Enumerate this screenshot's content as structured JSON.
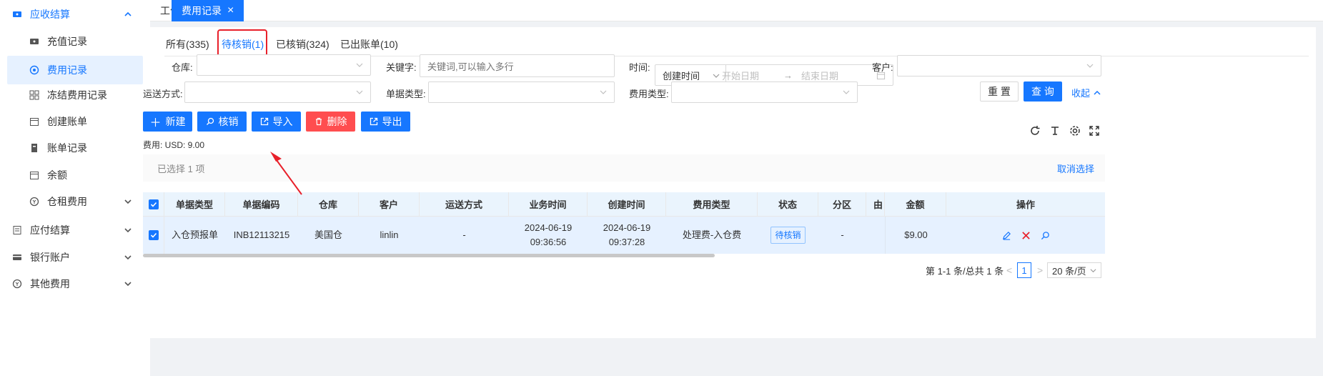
{
  "sidebar": {
    "items": [
      {
        "label": "应收结算",
        "icon": "ticket-icon",
        "level": "top",
        "expanded": true
      },
      {
        "label": "充值记录",
        "icon": "ticket-icon",
        "level": "sub"
      },
      {
        "label": "费用记录",
        "icon": "target-icon",
        "level": "sub",
        "active": true
      },
      {
        "label": "冻结费用记录",
        "icon": "grid-icon",
        "level": "sub"
      },
      {
        "label": "创建账单",
        "icon": "calendar-icon",
        "level": "sub"
      },
      {
        "label": "账单记录",
        "icon": "document-icon",
        "level": "sub"
      },
      {
        "label": "余额",
        "icon": "calendar-icon",
        "level": "sub"
      },
      {
        "label": "仓租费用",
        "icon": "coin-icon",
        "level": "sub",
        "collapsible": true
      },
      {
        "label": "应付结算",
        "icon": "receipt-icon",
        "level": "top",
        "collapsible": true
      },
      {
        "label": "银行账户",
        "icon": "card-icon",
        "level": "top",
        "collapsible": true
      },
      {
        "label": "其他费用",
        "icon": "coin-icon",
        "level": "top",
        "collapsible": true
      }
    ]
  },
  "page_tabs": [
    {
      "label": "工作台"
    },
    {
      "label": "费用记录",
      "active": true
    }
  ],
  "status_tabs": [
    {
      "label": "所有(335)"
    },
    {
      "label": "待核销(1)",
      "active": true
    },
    {
      "label": "已核销(324)"
    },
    {
      "label": "已出账单(10)"
    }
  ],
  "filters": {
    "warehouse_label": "仓库:",
    "keyword_label": "关键字:",
    "keyword_placeholder": "关键词,可以输入多行",
    "time_label": "时间:",
    "time_type": "创建时间",
    "start_date_placeholder": "开始日期",
    "range_arrow": "→",
    "end_date_placeholder": "结束日期",
    "customer_label": "客户:",
    "shipping_label": "运送方式:",
    "doc_type_label": "单据类型:",
    "fee_type_label": "费用类型:",
    "reset": "重 置",
    "search": "查 询",
    "collapse": "收起"
  },
  "actions": {
    "new": "新建",
    "verify": "核销",
    "import": "导入",
    "delete": "删除",
    "export": "导出"
  },
  "fee_summary": "费用: USD: 9.00",
  "selection": {
    "text": "已选择 1 项",
    "cancel": "取消选择"
  },
  "table": {
    "columns": [
      "单据类型",
      "单据编码",
      "仓库",
      "客户",
      "运送方式",
      "业务时间",
      "创建时间",
      "费用类型",
      "状态",
      "分区",
      "由",
      "金额",
      "操作"
    ],
    "rows": [
      {
        "doc_type": "入仓预报单",
        "doc_code": "INB12113215",
        "warehouse": "美国仓",
        "customer": "linlin",
        "shipping": "-",
        "biz_date": "2024-06-19",
        "biz_time": "09:36:56",
        "created_date": "2024-06-19",
        "created_time": "09:37:28",
        "fee_type": "处理费-入仓费",
        "status": "待核销",
        "zone": "-",
        "amount": "$9.00"
      }
    ]
  },
  "pagination": {
    "summary": "第 1-1 条/总共 1 条",
    "prev": "<",
    "current": "1",
    "next": ">",
    "page_size": "20 条/页"
  },
  "colors": {
    "primary": "#1677ff",
    "danger": "#ff4d4f",
    "annotation": "#e8202a"
  }
}
